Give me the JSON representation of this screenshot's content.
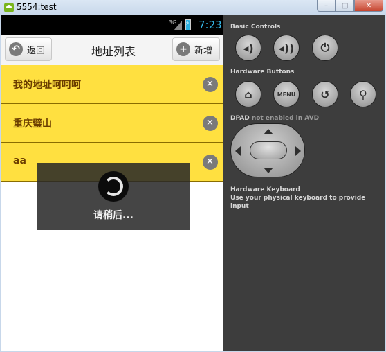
{
  "window": {
    "title": "5554:test",
    "buttons": [
      "–",
      "□",
      "✕"
    ]
  },
  "statusbar": {
    "network": "3G",
    "time": "7:23"
  },
  "header": {
    "back_label": "返回",
    "title": "地址列表",
    "add_label": "新增",
    "back_icon": "back-arrow-icon",
    "add_icon": "plus-icon"
  },
  "addresses": [
    {
      "name": "我的地址呵呵呵"
    },
    {
      "name": "重庆璧山"
    },
    {
      "name": "aa"
    }
  ],
  "loading": {
    "text": "请稍后..."
  },
  "controls": {
    "basic_controls": "Basic Controls",
    "hardware_buttons": "Hardware Buttons",
    "menu_label": "MENU",
    "dpad_title": "DPAD",
    "dpad_note": "not enabled in AVD",
    "keyboard_title": "Hardware Keyboard",
    "keyboard_note": "Use your physical keyboard to provide input"
  },
  "colors": {
    "row_background": "#ffe040",
    "row_text": "#6b3d00",
    "clock": "#33b5e5",
    "panel": "#3d3d3d"
  }
}
